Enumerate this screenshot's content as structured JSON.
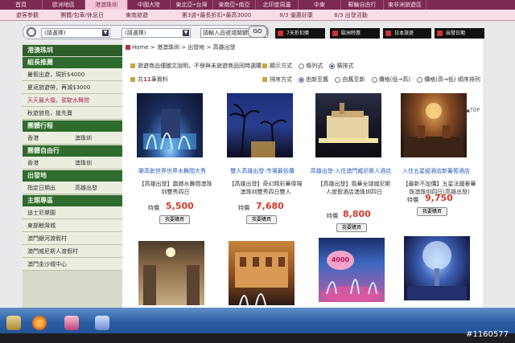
{
  "topnav": [
    "首頁",
    "歐洲地區",
    "港澳珠圳",
    "中國大陸",
    "東北亞•台灣",
    "東南亞•南亞",
    "北印度周邊",
    "中東",
    "郵輪自由行",
    "東非洲旅遊區"
  ],
  "subnav": [
    "遊客參觀",
    "團體/包車/休息日",
    "東南旅遊",
    "第3波•最長折扣•最高3000",
    "8/3 優惠好康",
    "8/3 出發活動"
  ],
  "search": {
    "select1": "(請選擇)",
    "select2": "(請選擇)",
    "keyword_placeholder": "請輸入品號或關鍵字",
    "go_label": "GO"
  },
  "promos": [
    "7天折扣價",
    "歐洲特惠",
    "日本旅遊",
    "出發日期"
  ],
  "sidebar": {
    "title": "港澳珠圳",
    "sections": [
      {
        "head": "組長推薦",
        "items": [
          {
            "label": "暑假出遊，現折$4000",
            "pink": false
          },
          {
            "label": "夏返旅遊帶，再減$3000",
            "pink": false
          },
          {
            "label": "天天最大檔，駕駛水舞間",
            "pink": true
          },
          {
            "label": "秋遊旅島，搶先賣",
            "pink": false
          }
        ]
      },
      {
        "head": "團體行程",
        "pairs": [
          [
            "香港",
            "澳珠圳"
          ]
        ]
      },
      {
        "head": "團體自由行",
        "pairs": [
          [
            "香港",
            "澳珠圳"
          ]
        ]
      },
      {
        "head": "出發地",
        "pairs": [
          [
            "指定日期出",
            "高雄出發"
          ]
        ]
      },
      {
        "head": "主題專區",
        "items": [
          {
            "label": "迪士尼樂園",
            "pink": false
          },
          {
            "label": "東部鯨灣城",
            "pink": false
          },
          {
            "label": "澳門銀河渡假村",
            "pink": false
          },
          {
            "label": "澳門威尼斯人渡假村",
            "pink": false
          },
          {
            "label": "澳門金沙城中心",
            "pink": false
          }
        ]
      }
    ]
  },
  "breadcrumb": "Home > 港澳珠圳 > 出發地 > 高雄出發",
  "notice": "旅遊商品僅圖文說明，不保與未旅遊商品同時選購",
  "count_prefix": "共",
  "count_value": "11",
  "count_suffix": "筆資料",
  "display": {
    "label": "顯示方式",
    "opt1": "條列式",
    "opt2": "橫排式"
  },
  "sort": {
    "label": "排序方式",
    "opt1": "由新至舊",
    "opt2": "由舊至新",
    "opt3": "價格(低→高)",
    "opt4": "價格(高→低)",
    "opt5": "順序排列"
  },
  "top_link": "▲TOP",
  "price_label": "特價",
  "buy_label": "我要購買",
  "products": [
    {
      "title": "樂高創世界世界水舞間大秀",
      "desc": "【高雄出發】震撼水舞間澳珠圳雙秀四日",
      "price": "5,500"
    },
    {
      "title": "雙人高雄出發-市場最低價",
      "desc": "【高雄出發】奇幻精彩華偉場澳珠圳雙秀四日雙人",
      "price": "7,680"
    },
    {
      "title": "高雄出發-入住澳門威尼斯人酒店",
      "desc": "【高雄出發】風華全球威尼斯人度假酒店澳珠圳四日",
      "price": "8,800"
    },
    {
      "title": "入住五星級酒店新葡萄酒店",
      "desc": "【最新不加價】五星法國奢華珠澳珠圳四日(高雄出發)",
      "price": "9,750"
    }
  ],
  "badge": "4000",
  "taskbar_apps": [
    "start",
    "media",
    "browser",
    "network"
  ],
  "watermark": "#1160577",
  "colors": {
    "nav": "#7b2a52",
    "sidebar_head": "#2f6a2e",
    "price": "#d23a2a",
    "link": "#2a5bb8"
  }
}
